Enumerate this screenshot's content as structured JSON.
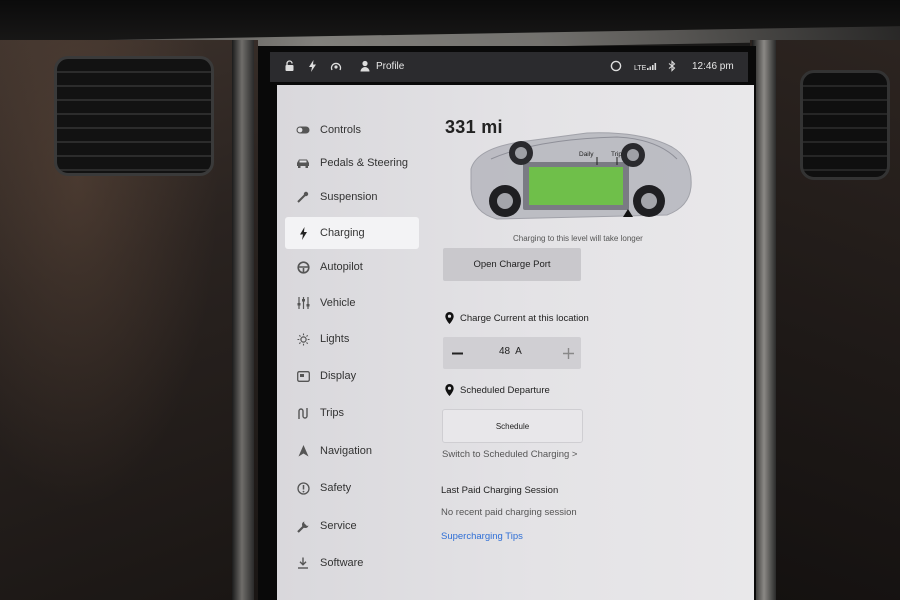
{
  "status_bar": {
    "profile_label": "Profile",
    "network": "LTE",
    "time": "12:46 pm"
  },
  "sidebar": {
    "items": [
      {
        "label": "Controls",
        "icon": "toggle-icon"
      },
      {
        "label": "Pedals & Steering",
        "icon": "car-icon"
      },
      {
        "label": "Suspension",
        "icon": "wrench-slant-icon"
      },
      {
        "label": "Charging",
        "icon": "bolt-icon",
        "active": true
      },
      {
        "label": "Autopilot",
        "icon": "steering-wheel-icon"
      },
      {
        "label": "Vehicle",
        "icon": "sliders-icon"
      },
      {
        "label": "Lights",
        "icon": "sun-icon"
      },
      {
        "label": "Display",
        "icon": "display-icon"
      },
      {
        "label": "Trips",
        "icon": "trips-icon"
      },
      {
        "label": "Navigation",
        "icon": "navigation-arrow-icon"
      },
      {
        "label": "Safety",
        "icon": "info-circle-icon"
      },
      {
        "label": "Service",
        "icon": "wrench-icon"
      },
      {
        "label": "Software",
        "icon": "download-icon"
      }
    ]
  },
  "charging": {
    "range": "331 mi",
    "charge_limit_labels": {
      "daily": "Daily",
      "trip": "Trip"
    },
    "charge_level": 0.6,
    "charge_note": "Charging to this level will take longer",
    "open_charge_port": "Open Charge Port",
    "charge_current_label": "Charge Current at this location",
    "current_value": "48",
    "current_unit": "A",
    "scheduled_departure_label": "Scheduled Departure",
    "schedule_button": "Schedule",
    "switch_link": "Switch to Scheduled Charging >",
    "last_paid_title": "Last Paid Charging Session",
    "no_recent": "No recent paid charging session",
    "supercharging_tips": "Supercharging Tips"
  },
  "colors": {
    "accent_link": "#2f6fd6",
    "battery_green": "#6fbf4a",
    "panel_bg": "#e4e3e6",
    "status_bar_bg": "#2b2b2e"
  }
}
